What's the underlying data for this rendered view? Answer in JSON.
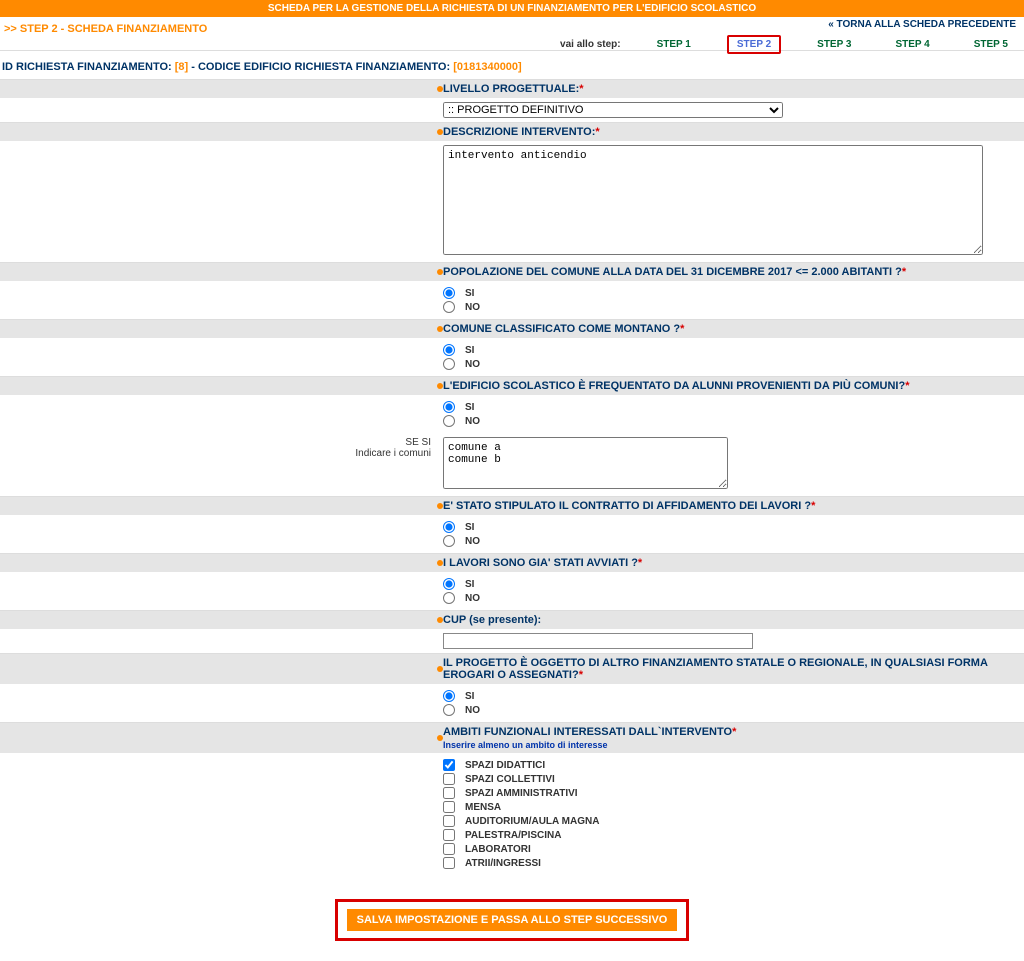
{
  "banner": "SCHEDA PER LA GESTIONE DELLA RICHIESTA DI UN FINANZIAMENTO PER L'EDIFICIO SCOLASTICO",
  "crumb": ">> STEP 2 - SCHEDA FINANZIAMENTO",
  "back": "« TORNA ALLA SCHEDA PRECEDENTE",
  "nav": {
    "lbl": "vai allo step:",
    "s1": "STEP 1",
    "s2": "STEP 2",
    "s3": "STEP 3",
    "s4": "STEP 4",
    "s5": "STEP 5"
  },
  "id": {
    "t1": "ID RICHIESTA FINANZIAMENTO: ",
    "v1": "[8]",
    "t2": " - CODICE EDIFICIO RICHIESTA FINANZIAMENTO: ",
    "v2": "[0181340000]"
  },
  "f": {
    "livello": {
      "label": "LIVELLO PROGETTUALE:",
      "value": ":: PROGETTO DEFINITIVO"
    },
    "descr": {
      "label": "DESCRIZIONE INTERVENTO:",
      "value": "intervento anticendio"
    },
    "pop": {
      "label": "POPOLAZIONE DEL COMUNE ALLA DATA DEL 31 DICEMBRE 2017 <= 2.000 ABITANTI ?"
    },
    "mont": {
      "label": "COMUNE CLASSIFICATO COME MONTANO ?"
    },
    "alunni": {
      "label": "L'EDIFICIO SCOLASTICO È FREQUENTATO DA ALUNNI PROVENIENTI DA PIÙ COMUNI?"
    },
    "comuni": {
      "side1": "SE SI",
      "side2": "Indicare i comuni",
      "value": "comune a\ncomune b"
    },
    "contratto": {
      "label": "E' STATO STIPULATO IL CONTRATTO DI AFFIDAMENTO DEI LAVORI ?"
    },
    "lavori": {
      "label": "I LAVORI SONO GIA' STATI AVVIATI ?"
    },
    "cup": {
      "label": "CUP (se presente):"
    },
    "altro": {
      "label": "IL PROGETTO È OGGETTO DI ALTRO FINANZIAMENTO STATALE O REGIONALE, IN QUALSIASI FORMA EROGARI O ASSEGNATI?"
    },
    "ambiti": {
      "label": "AMBITI FUNZIONALI INTERESSATI DALL`INTERVENTO",
      "sub": "Inserire almeno un ambito di interesse",
      "items": {
        "c0": "SPAZI DIDATTICI",
        "c1": "SPAZI COLLETTIVI",
        "c2": "SPAZI AMMINISTRATIVI",
        "c3": "MENSA",
        "c4": "AUDITORIUM/AULA MAGNA",
        "c5": "PALESTRA/PISCINA",
        "c6": "LABORATORI",
        "c7": "ATRII/INGRESSI"
      }
    }
  },
  "opt": {
    "si": "SI",
    "no": "NO"
  },
  "save": "SALVA IMPOSTAZIONE E PASSA ALLO STEP SUCCESSIVO"
}
